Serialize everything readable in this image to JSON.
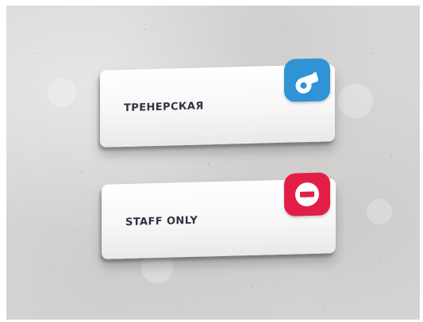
{
  "signs": [
    {
      "label": "ТРЕНЕРСКАЯ",
      "icon": "whistle-icon",
      "badge_color": "#2f93d6"
    },
    {
      "label": "STAFF ONLY",
      "icon": "no-entry-icon",
      "badge_color": "#e21e47"
    }
  ]
}
